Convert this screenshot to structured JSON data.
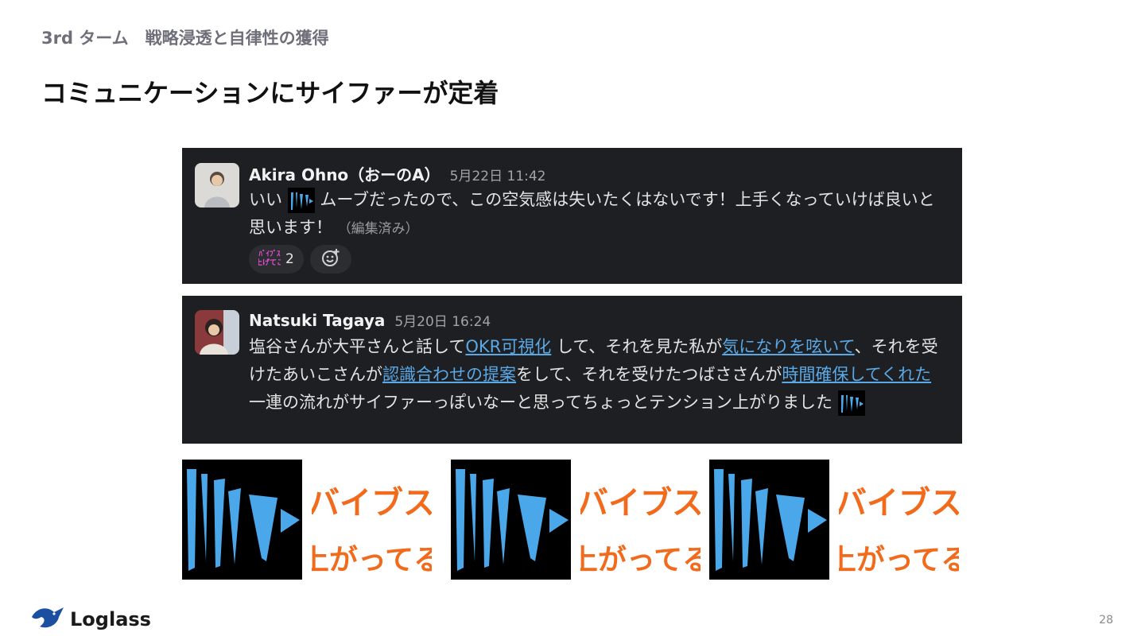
{
  "header": {
    "subtitle": "3rd ターム　戦略浸透と自律性の獲得",
    "title": "コミュニケーションにサイファーが定着"
  },
  "message1": {
    "author": "Akira Ohno（おーのA）",
    "time": "5月22日 11:42",
    "text_a": "いい",
    "text_b": "ムーブだったので、この空気感は失いたくはないです！上手くなっていけば良いと思います！",
    "edited": "（編集済み）",
    "reaction_count": "2",
    "reaction_emoji_label": "バイブス上げてこ"
  },
  "message2": {
    "author": "Natsuki Tagaya",
    "time": "5月20日 16:24",
    "t1": "塩谷さんが大平さんと話して",
    "l1": "OKR可視化",
    "t2": " して、それを見た私が",
    "l2": "気になりを呟いて",
    "t3": "、それを受けたあいこさんが",
    "l3": "認識合わせの提案",
    "t4": "をして、それを受けたつばささんが",
    "l4": "時間確保してくれた",
    "t5": "　一連の流れがサイファーっぽいなーと思ってちょっとテンション上がりました"
  },
  "stamps": {
    "cipher_label": "サイファー",
    "vibes_line1": "バイブス",
    "vibes_line2": "上がってる",
    "cipher_color": "#4aa8ea",
    "vibes_color": "#f26a1b"
  },
  "footer": {
    "logo_text": "Loglass",
    "page_number": "28"
  }
}
